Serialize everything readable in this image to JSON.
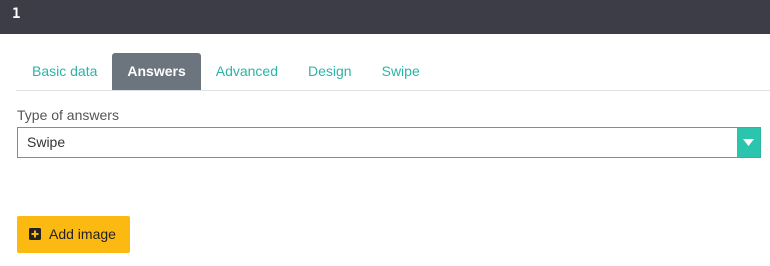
{
  "header": {
    "number": "1"
  },
  "tabs": [
    {
      "label": "Basic data",
      "active": false
    },
    {
      "label": "Answers",
      "active": true
    },
    {
      "label": "Advanced",
      "active": false
    },
    {
      "label": "Design",
      "active": false
    },
    {
      "label": "Swipe",
      "active": false
    }
  ],
  "answers_form": {
    "type_label": "Type of answers",
    "type_value": "Swipe",
    "add_image_label": "Add image"
  },
  "icons": {
    "dropdown": "chevron-down-icon",
    "add": "plus-square-icon"
  },
  "colors": {
    "accent": "#2bb5a4",
    "active_tab": "#6c757d",
    "header": "#3c3d47",
    "button": "#fbb911"
  }
}
